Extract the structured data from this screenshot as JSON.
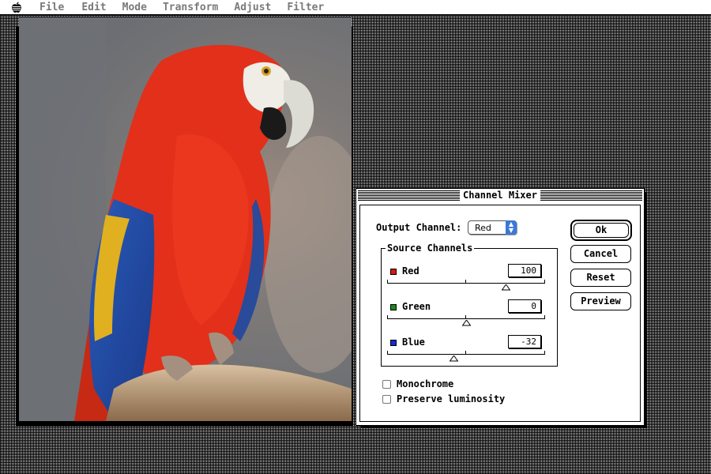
{
  "menubar": {
    "items": [
      "File",
      "Edit",
      "Mode",
      "Transform",
      "Adjust",
      "Filter"
    ]
  },
  "dialog": {
    "title": "Channel Mixer",
    "output_channel_label": "Output Channel:",
    "output_channel_value": "Red",
    "source_channels_label": "Source Channels",
    "channels": [
      {
        "label": "Red",
        "value": "100",
        "color": "#d21a1a",
        "slider_fraction": 0.75
      },
      {
        "label": "Green",
        "value": "0",
        "color": "#1a8a1a",
        "slider_fraction": 0.5
      },
      {
        "label": "Blue",
        "value": "-32",
        "color": "#1a2ad2",
        "slider_fraction": 0.42
      }
    ],
    "monochrome_label": "Monochrome",
    "preserve_luminosity_label": "Preserve luminosity",
    "monochrome_checked": false,
    "preserve_luminosity_checked": false,
    "buttons": {
      "ok": "Ok",
      "cancel": "Cancel",
      "reset": "Reset",
      "preview": "Preview"
    }
  },
  "image": {
    "subject": "macaw-photo"
  }
}
